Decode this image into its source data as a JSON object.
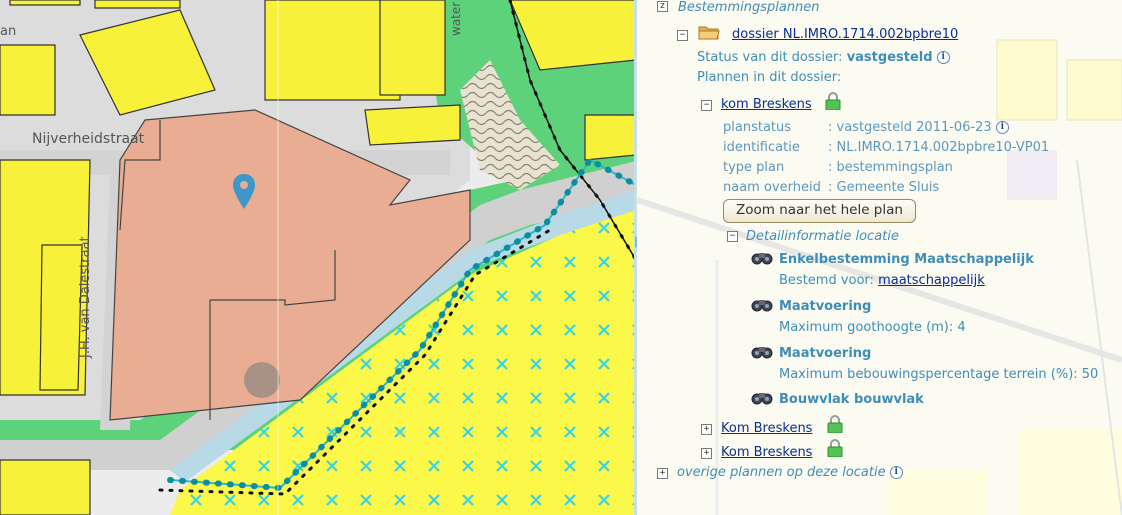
{
  "tree": {
    "root_label": "Bestemmingsplannen",
    "dossier_link": "dossier NL.IMRO.1714.002bpbre10",
    "status_label": "Status van dit dossier:",
    "status_value": "vastgesteld",
    "plans_label": "Plannen in dit dossier:",
    "plan_link": "kom Breskens",
    "fields": [
      {
        "key": "planstatus",
        "value": ": vastgesteld 2011-06-23"
      },
      {
        "key": "identificatie",
        "value": ": NL.IMRO.1714.002bpbre10-VP01"
      },
      {
        "key": "type plan",
        "value": ": bestemmingsplan"
      },
      {
        "key": "naam overheid",
        "value": ": Gemeente Sluis"
      }
    ],
    "zoom_button": "Zoom naar het hele plan",
    "detail_label": "Detailinformatie locatie",
    "details": [
      {
        "title": "Enkelbestemming Maatschappelijk",
        "sub_label": "Bestemd voor:",
        "sub_link": "maatschappelijk"
      },
      {
        "title": "Maatvoering",
        "sub_label": "Maximum goothoogte (m): 4"
      },
      {
        "title": "Maatvoering",
        "sub_label": "Maximum bebouwingspercentage terrein (%): 50"
      },
      {
        "title": "Bouwvlak bouwvlak"
      }
    ],
    "other_plans": [
      "Kom Breskens",
      "Kom Breskens"
    ],
    "overige_label": "overige plannen op deze locatie"
  },
  "map": {
    "street_1": "Nijverheidstraat",
    "street_2": "J.H. van Dalestraat",
    "street_3": "water",
    "street_4": "an"
  },
  "icons": {
    "toggle_collapse": "−",
    "toggle_expand": "+",
    "root_toggle": "z",
    "info": "i"
  }
}
